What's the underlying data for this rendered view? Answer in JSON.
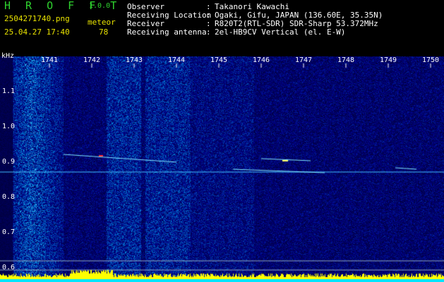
{
  "header": {
    "brand": "H R O F F T",
    "version": "1.0.0",
    "filename": "2504271740.png",
    "plot_type": "meteor",
    "datetime": "25.04.27 17:40",
    "count": "78",
    "info": [
      {
        "label": "Observer",
        "value": "Takanori Kawachi"
      },
      {
        "label": "Receiving Location",
        "value": "Ogaki, Gifu, JAPAN (136.60E, 35.35N)"
      },
      {
        "label": "Receiver",
        "value": "R820T2(RTL-SDR) SDR-Sharp 53.372MHz"
      },
      {
        "label": "Receiving antenna",
        "value": "2el-HB9CV Vertical (el. E-W)"
      }
    ]
  },
  "axes": {
    "y_unit": "kHz",
    "y_ticks": [
      "1.1",
      "1.0",
      "0.9",
      "0.8",
      "0.7",
      "0.6"
    ],
    "x_ticks": [
      "1741",
      "1742",
      "1743",
      "1744",
      "1745",
      "1746",
      "1747",
      "1748",
      "1749",
      "1750"
    ]
  },
  "colors": {
    "background": "#000000",
    "header_green": "#2fd32f",
    "header_yellow": "#e8e200",
    "spectrum_low": "#00008b",
    "spectrum_high": "#00ffff",
    "carrier": "#40c0ff",
    "bottom_bar": "#00e5ff",
    "bottom_peaks": "#ffff00"
  }
}
